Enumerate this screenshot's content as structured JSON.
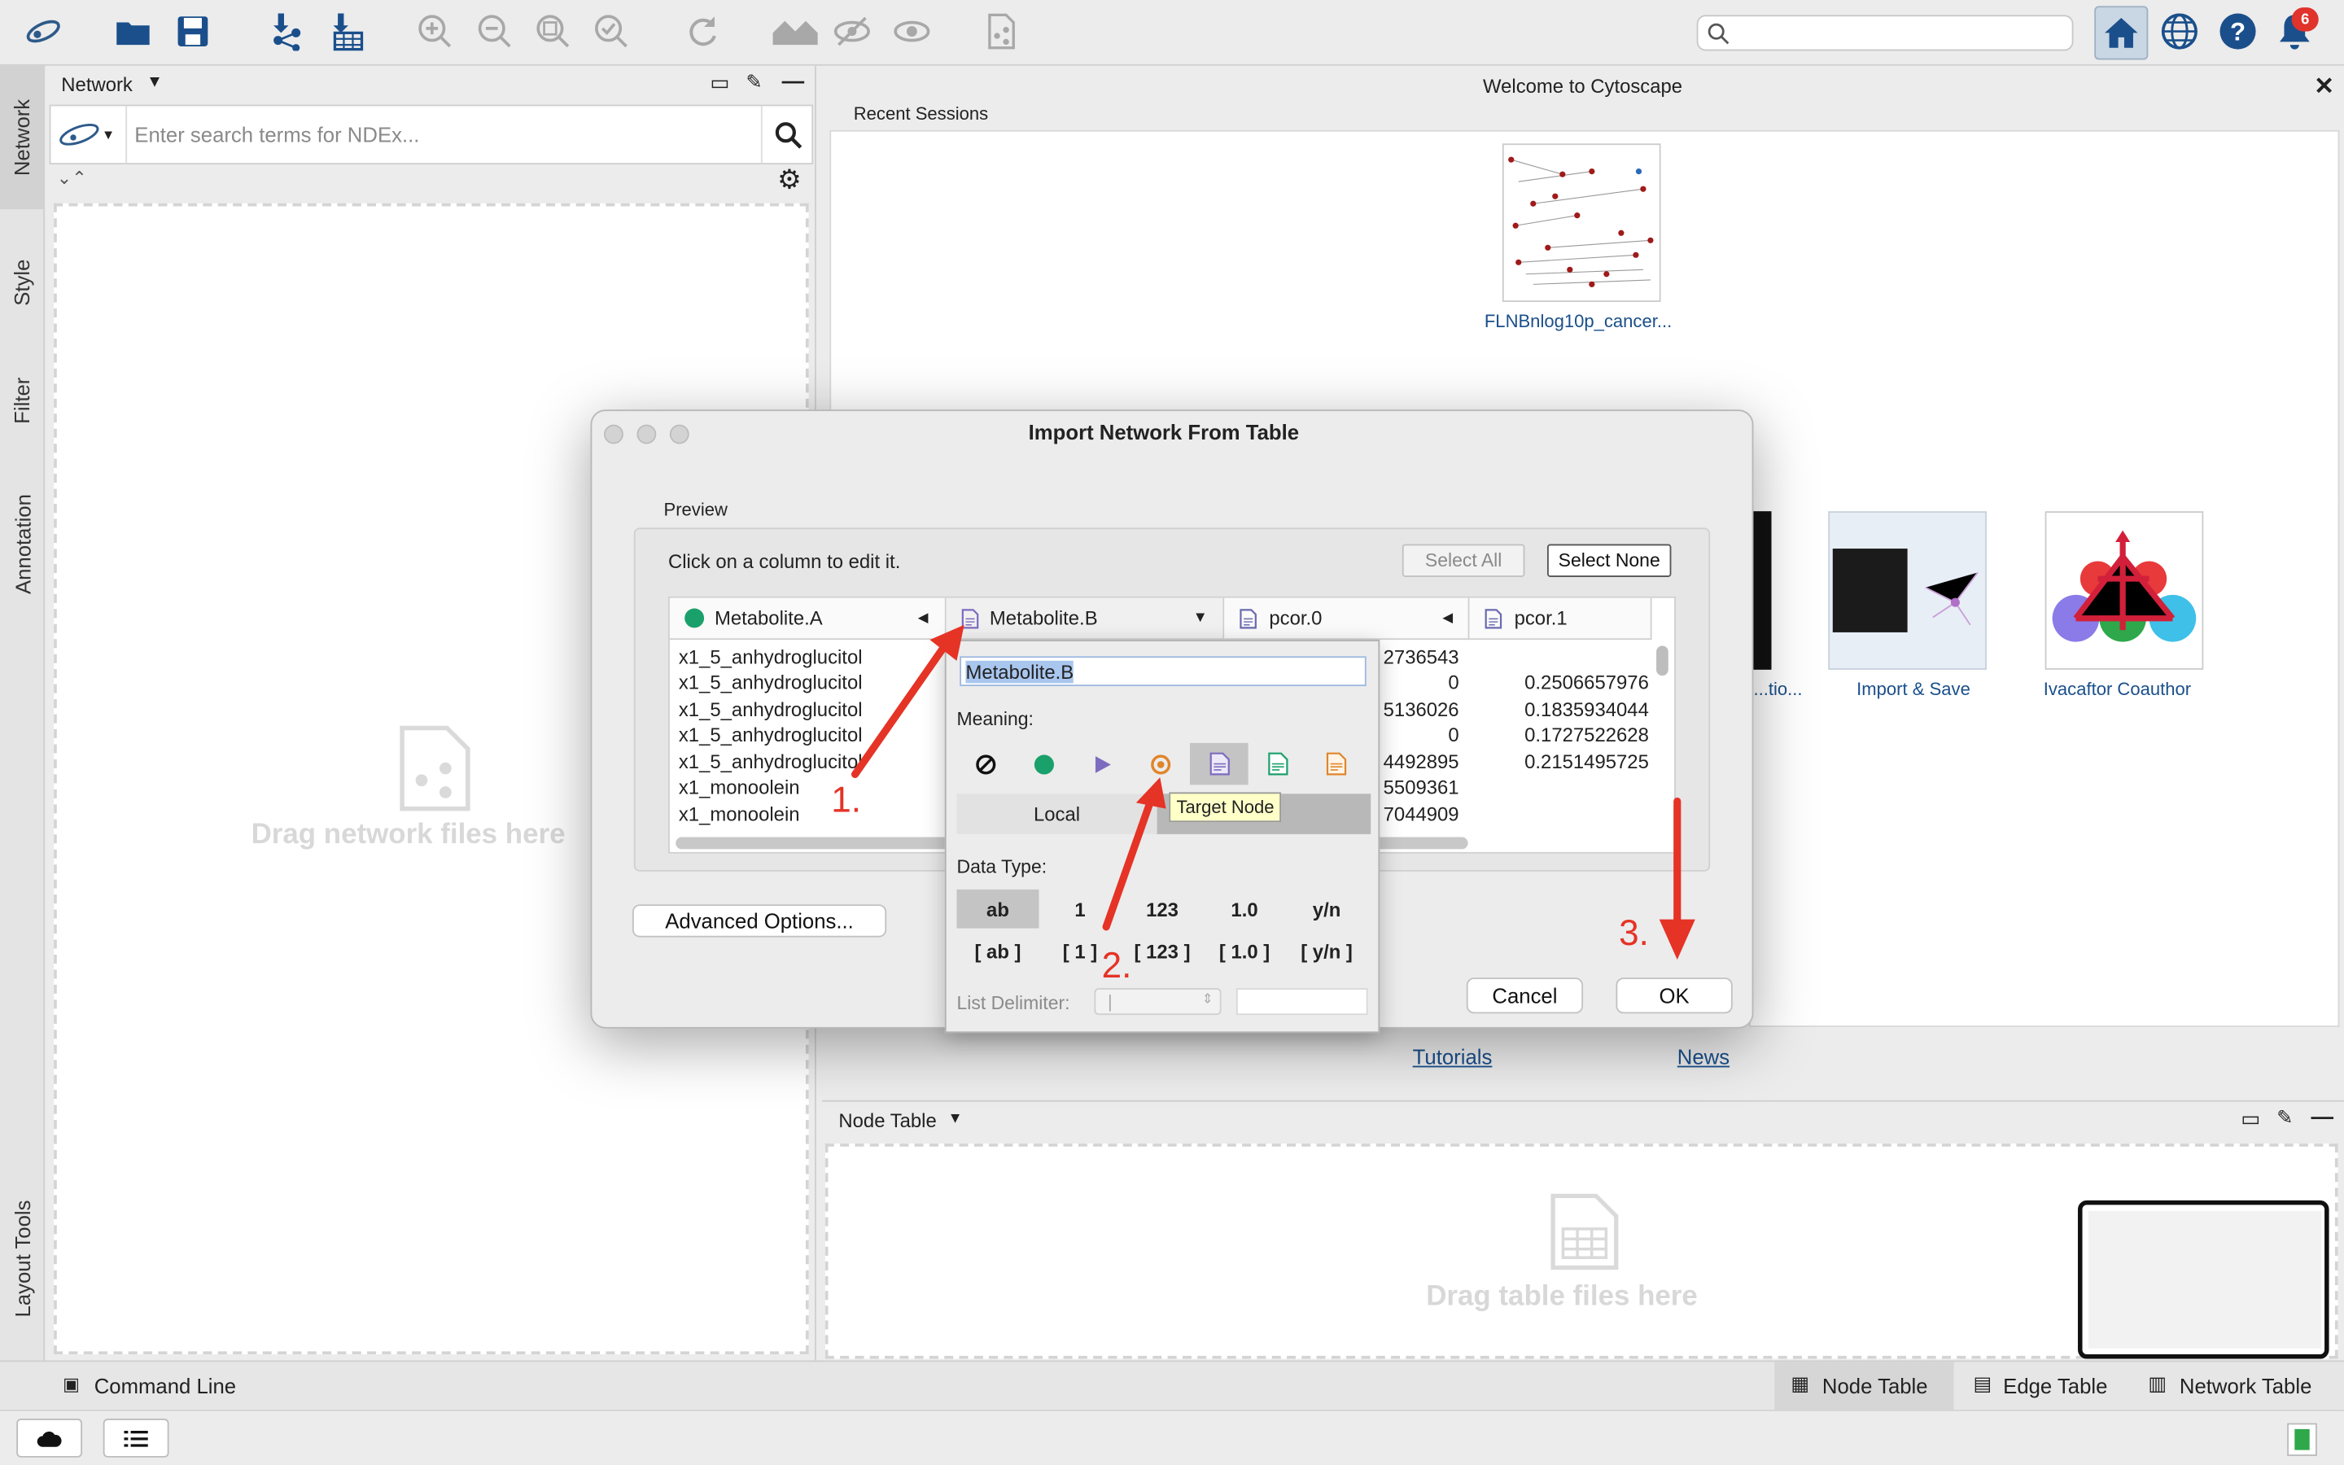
{
  "toolbar": {
    "search_placeholder": "",
    "notification_count": "6"
  },
  "vtabs": [
    "Network",
    "Style",
    "Filter",
    "Annotation",
    "Layout Tools"
  ],
  "network_panel": {
    "title": "Network",
    "search_placeholder": "Enter search terms for NDEx...",
    "drop_text": "Drag network files here"
  },
  "welcome": {
    "title": "Welcome to Cytoscape",
    "recent_sessions": "Recent Sessions",
    "session_name": "FLNBnlog10p_cancer...",
    "sample_partial": "...tio...",
    "sample_import": "Import & Save",
    "sample_ivacaftor": "Ivacaftor Coauthor",
    "tutorials": "Tutorials",
    "news": "News"
  },
  "node_table": {
    "title": "Node Table",
    "drop_text": "Drag table files here"
  },
  "bottom": {
    "command_line": "Command Line",
    "tabs": [
      "Node Table",
      "Edge Table",
      "Network Table"
    ]
  },
  "dialog": {
    "title": "Import Network From Table",
    "preview_label": "Preview",
    "instruction": "Click on a column to edit it.",
    "select_all": "Select All",
    "select_none": "Select None",
    "advanced_options": "Advanced Options...",
    "cancel": "Cancel",
    "ok": "OK",
    "columns": [
      "Metabolite.A",
      "Metabolite.B",
      "pcor.0",
      "pcor.1"
    ],
    "rows": [
      {
        "a": "x1_5_anhydroglucitol",
        "c": "2736543",
        "d": ""
      },
      {
        "a": "x1_5_anhydroglucitol",
        "c": "0",
        "d": "0.2506657976"
      },
      {
        "a": "x1_5_anhydroglucitol",
        "c": "5136026",
        "d": "0.1835934044"
      },
      {
        "a": "x1_5_anhydroglucitol",
        "c": "0",
        "d": "0.1727522628"
      },
      {
        "a": "x1_5_anhydroglucitol",
        "c": "4492895",
        "d": "0.2151495725"
      },
      {
        "a": "x1_monoolein",
        "c": "5509361",
        "d": ""
      },
      {
        "a": "x1_monoolein",
        "c": "7044909",
        "d": ""
      }
    ]
  },
  "popup": {
    "name_value": "Metabolite.B",
    "meaning_label": "Meaning:",
    "local_label": "Local",
    "shared_label_partial": "d",
    "data_type_label": "Data Type:",
    "types_row1": [
      "ab",
      "1",
      "123",
      "1.0",
      "y/n"
    ],
    "types_row2": [
      "[ ab ]",
      "[ 1 ]",
      "[ 123 ]",
      "[ 1.0 ]",
      "[ y/n ]"
    ],
    "list_delimiter_label": "List Delimiter:",
    "list_delimiter_value": "|",
    "tooltip": "Target Node"
  },
  "annotations": {
    "step1": "1.",
    "step2": "2.",
    "step3": "3."
  },
  "colors": {
    "accent_blue": "#1a4f8b",
    "source_node_green": "#1aa06b",
    "arrow_red": "#e53326",
    "target_orange": "#e0852a",
    "interaction_purple": "#7d6bbf"
  }
}
